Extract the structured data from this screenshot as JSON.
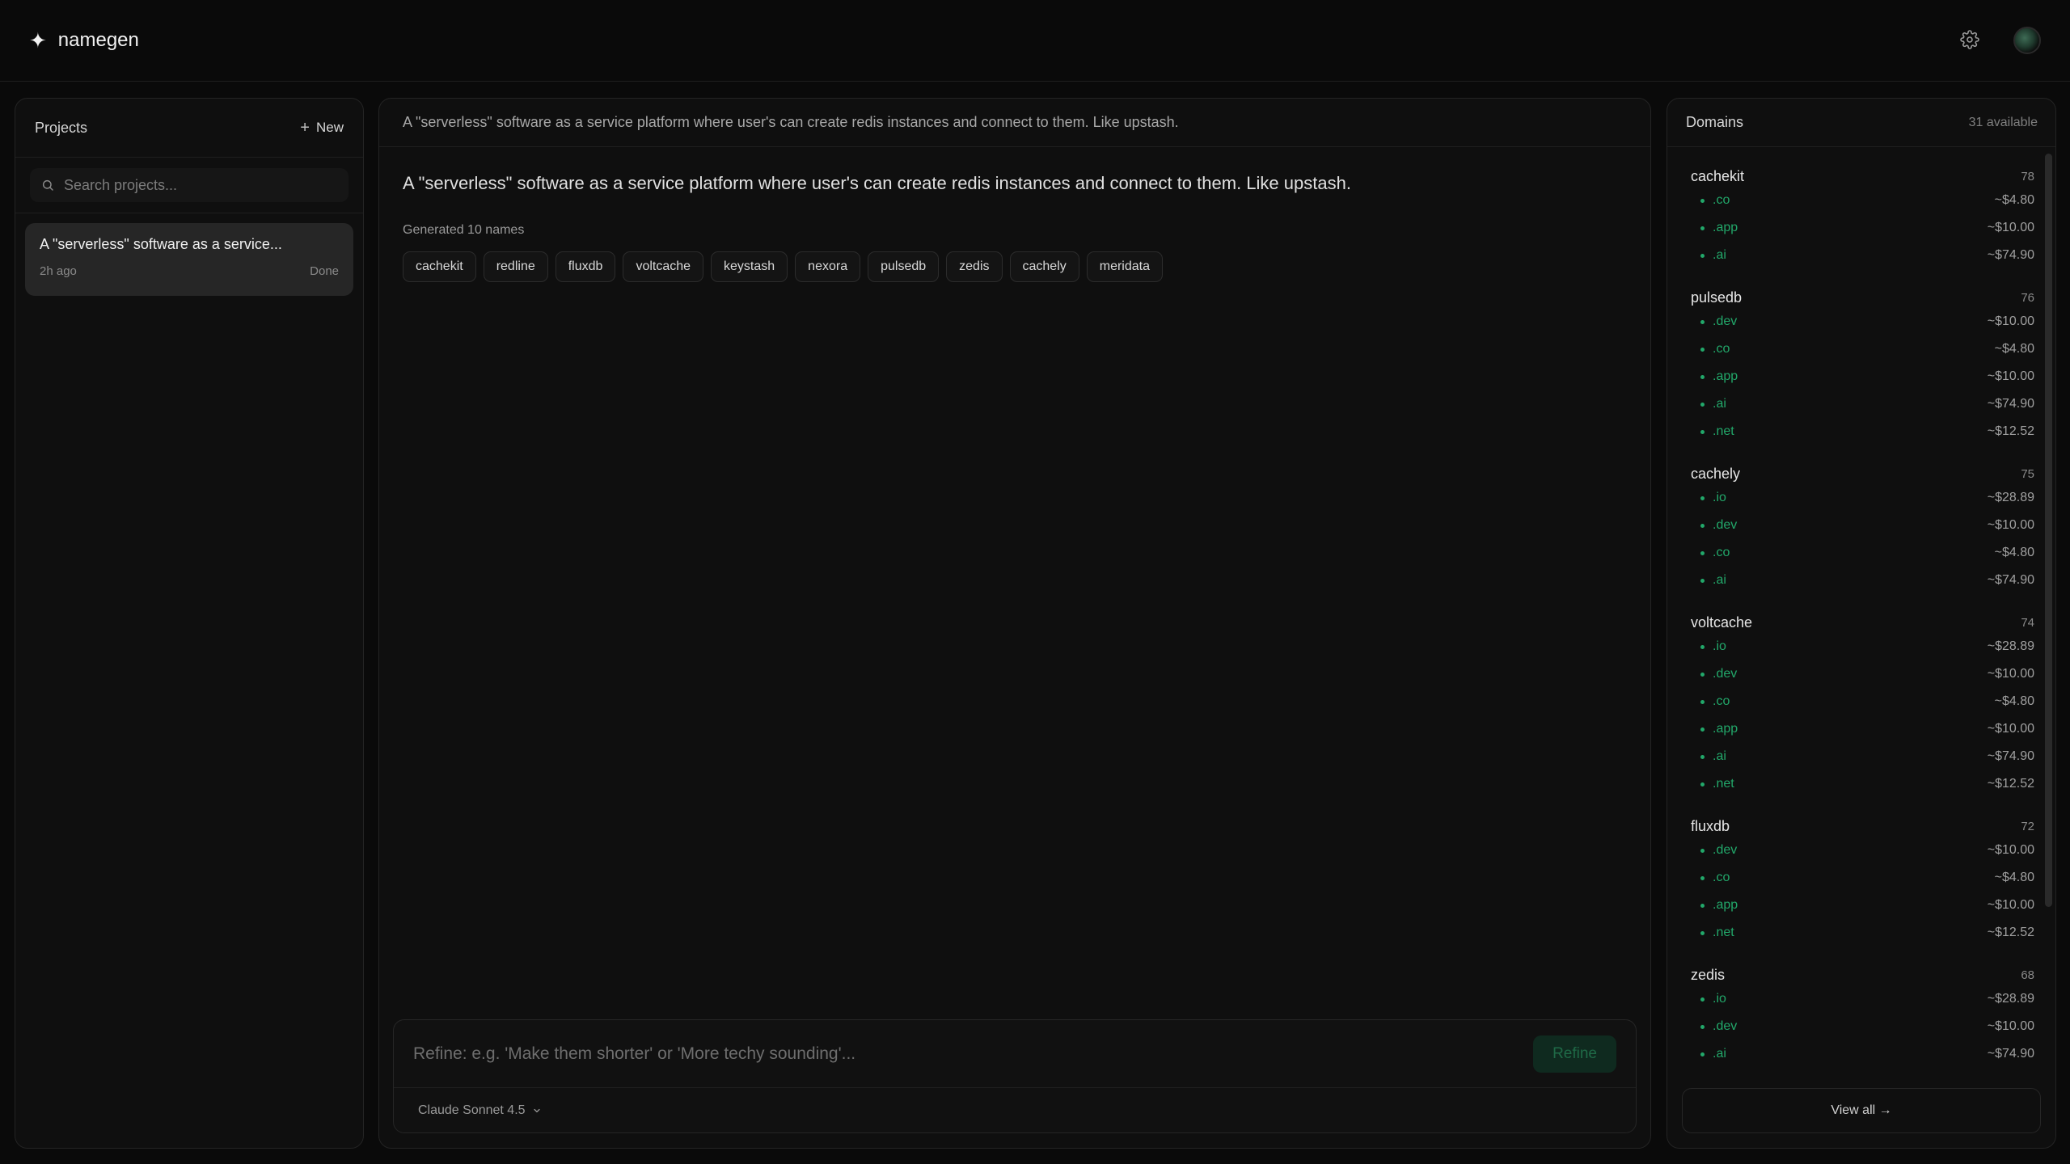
{
  "app": {
    "logo_glyph": "✦",
    "name": "namegen"
  },
  "header": {
    "settings_icon": "gear-icon",
    "avatar": "avatar"
  },
  "projects": {
    "title": "Projects",
    "new_label": "New",
    "search_placeholder": "Search projects...",
    "items": [
      {
        "title": "A \"serverless\" software as a service...",
        "time": "2h ago",
        "status": "Done"
      }
    ]
  },
  "main": {
    "header_prompt": "A \"serverless\" software as a service platform where user's can create redis instances and connect to them. Like upstash.",
    "prompt": "A \"serverless\" software as a service platform where user's can create redis instances and connect to them. Like upstash.",
    "generated_label": "Generated 10 names",
    "names": [
      "cachekit",
      "redline",
      "fluxdb",
      "voltcache",
      "keystash",
      "nexora",
      "pulsedb",
      "zedis",
      "cachely",
      "meridata"
    ],
    "refine_placeholder": "Refine: e.g. 'Make them shorter' or 'More techy sounding'...",
    "refine_button": "Refine",
    "model": "Claude Sonnet 4.5"
  },
  "domains": {
    "title": "Domains",
    "available": "31 available",
    "view_all": "View all →",
    "colors": {
      "tld": "#22a86a"
    },
    "groups": [
      {
        "name": "cachekit",
        "score": "78",
        "tlds": [
          {
            "tld": ".co",
            "price": "~$4.80"
          },
          {
            "tld": ".app",
            "price": "~$10.00"
          },
          {
            "tld": ".ai",
            "price": "~$74.90"
          }
        ]
      },
      {
        "name": "pulsedb",
        "score": "76",
        "tlds": [
          {
            "tld": ".dev",
            "price": "~$10.00"
          },
          {
            "tld": ".co",
            "price": "~$4.80"
          },
          {
            "tld": ".app",
            "price": "~$10.00"
          },
          {
            "tld": ".ai",
            "price": "~$74.90"
          },
          {
            "tld": ".net",
            "price": "~$12.52"
          }
        ]
      },
      {
        "name": "cachely",
        "score": "75",
        "tlds": [
          {
            "tld": ".io",
            "price": "~$28.89"
          },
          {
            "tld": ".dev",
            "price": "~$10.00"
          },
          {
            "tld": ".co",
            "price": "~$4.80"
          },
          {
            "tld": ".ai",
            "price": "~$74.90"
          }
        ]
      },
      {
        "name": "voltcache",
        "score": "74",
        "tlds": [
          {
            "tld": ".io",
            "price": "~$28.89"
          },
          {
            "tld": ".dev",
            "price": "~$10.00"
          },
          {
            "tld": ".co",
            "price": "~$4.80"
          },
          {
            "tld": ".app",
            "price": "~$10.00"
          },
          {
            "tld": ".ai",
            "price": "~$74.90"
          },
          {
            "tld": ".net",
            "price": "~$12.52"
          }
        ]
      },
      {
        "name": "fluxdb",
        "score": "72",
        "tlds": [
          {
            "tld": ".dev",
            "price": "~$10.00"
          },
          {
            "tld": ".co",
            "price": "~$4.80"
          },
          {
            "tld": ".app",
            "price": "~$10.00"
          },
          {
            "tld": ".net",
            "price": "~$12.52"
          }
        ]
      },
      {
        "name": "zedis",
        "score": "68",
        "tlds": [
          {
            "tld": ".io",
            "price": "~$28.89"
          },
          {
            "tld": ".dev",
            "price": "~$10.00"
          },
          {
            "tld": ".ai",
            "price": "~$74.90"
          }
        ]
      }
    ]
  }
}
